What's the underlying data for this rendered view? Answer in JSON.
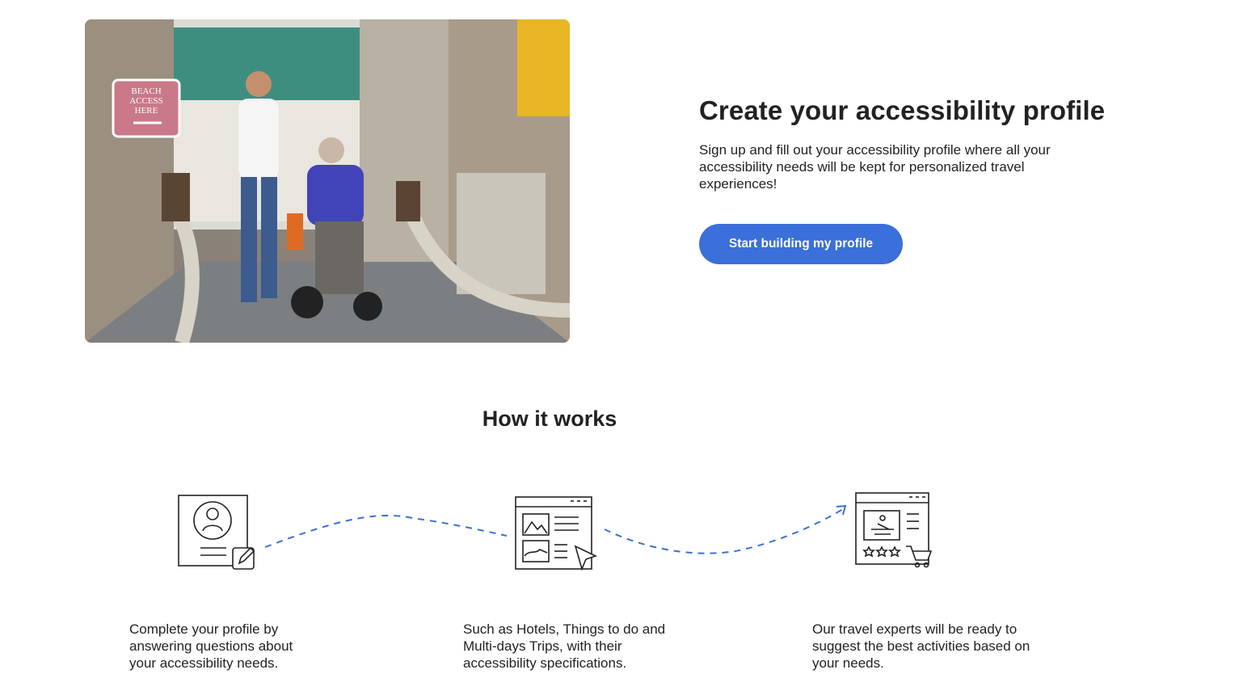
{
  "hero": {
    "title": "Create your accessibility profile",
    "description": "Sign up and fill out your accessibility profile where all your accessibility needs will be kept for personalized travel experiences!",
    "cta_label": "Start building my profile",
    "photo_sign_text": [
      "BEACH",
      "ACCESS",
      "HERE"
    ],
    "accent_color": "#3b6fd9"
  },
  "how_it_works": {
    "title": "How it works",
    "steps": [
      {
        "icon": "profile-document-icon",
        "text": "Complete your profile by answering questions about your accessibility needs."
      },
      {
        "icon": "listing-browser-icon",
        "text": "Such as Hotels, Things to do and Multi-days Trips, with their accessibility specifications."
      },
      {
        "icon": "activity-booking-icon",
        "text": "Our travel experts will be ready to suggest the best activities based on your needs."
      }
    ]
  }
}
